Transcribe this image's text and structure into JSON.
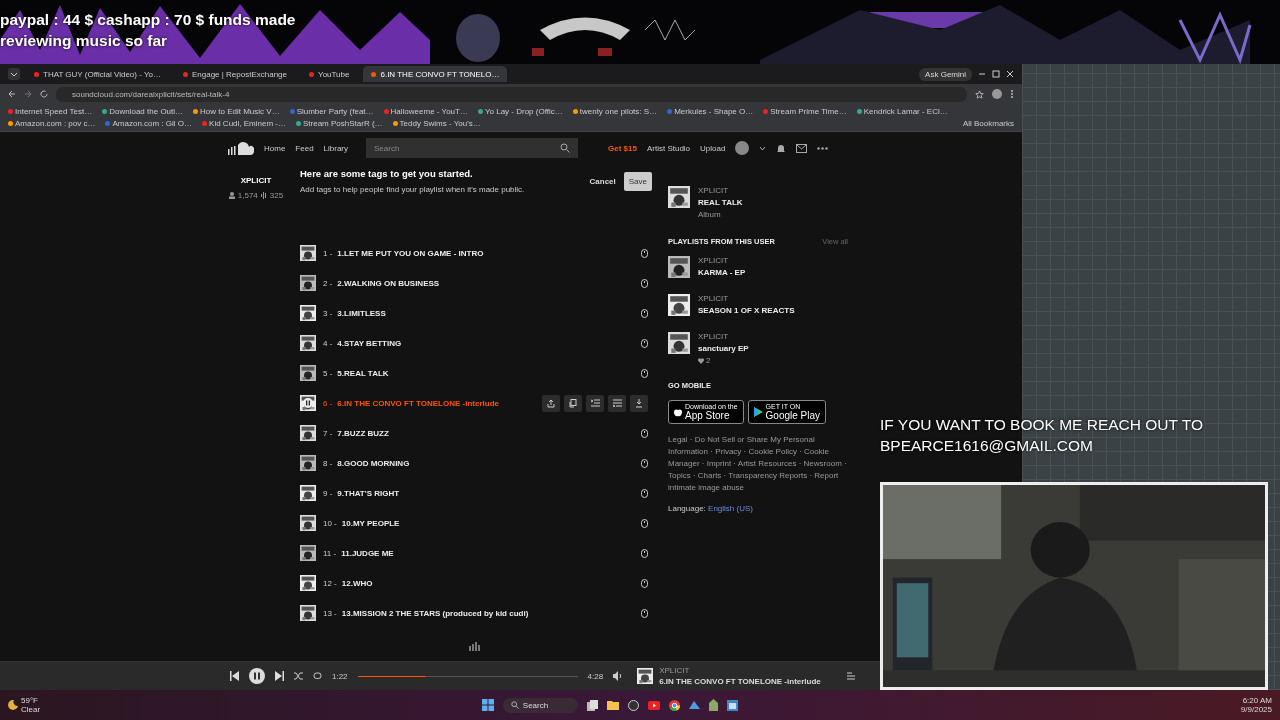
{
  "overlay": {
    "funds_lines": [
      "paypal : 44 $  cashapp : 70 $ funds made",
      "reviewing music so far"
    ],
    "booking_lines": [
      "IF YOU WANT TO BOOK ME REACH OUT TO",
      "BPEARCE1616@GMAIL.COM"
    ]
  },
  "browser": {
    "tabs": [
      {
        "title": "THAT GUY (Official Video) - Yo…",
        "selected": false
      },
      {
        "title": "Engage | RepostExchange",
        "selected": false
      },
      {
        "title": "YouTube",
        "selected": false
      },
      {
        "title": "6.IN THE CONVO FT TONELO…",
        "selected": true
      }
    ],
    "gemini_button": "Ask Gemini",
    "url": "soundcloud.com/darealxplicit/sets/real-talk-4",
    "bookmarks": [
      "Internet Speed Test…",
      "Download the Outl…",
      "How to Edit Music V…",
      "Slumber Party (feat…",
      "Halloweeme - YouT…",
      "Yo Lay - Drop (Offic…",
      "twenty one pilots: S…",
      "Merkules - Shape O…",
      "Stream Prime Time…",
      "Kendrick Lamar - ECl…",
      "Amazon.com : pov c…",
      "Amazon.com : Gil O…",
      "Kid Cudi, Eminem -…",
      "Stream PoshStarR (…",
      "Teddy Swims - You's…"
    ],
    "all_bookmarks": "All Bookmarks"
  },
  "header": {
    "nav": [
      "Home",
      "Feed",
      "Library"
    ],
    "search_placeholder": "Search",
    "promo": "Get $15",
    "links": [
      "Artist Studio",
      "Upload"
    ]
  },
  "profile": {
    "name": "XPLICIT",
    "followers": "1,574",
    "following": "325"
  },
  "tags_prompt": {
    "title": "Here are some tags to get you started.",
    "text": "Add tags to help people find your playlist when it's made public.",
    "cancel": "Cancel",
    "save": "Save"
  },
  "tracks": [
    {
      "number": "1 -",
      "title": "1.LET ME PUT YOU ON GAME - INTRO",
      "selected": false
    },
    {
      "number": "2 -",
      "title": "2.WALKING ON BUSINESS",
      "selected": false
    },
    {
      "number": "3 -",
      "title": "3.LIMITLESS",
      "selected": false
    },
    {
      "number": "4 -",
      "title": "4.STAY BETTING",
      "selected": false
    },
    {
      "number": "5 -",
      "title": "5.REAL TALK",
      "selected": false
    },
    {
      "number": "6 -",
      "title": "6.IN THE CONVO FT TONELONE -interlude",
      "selected": true
    },
    {
      "number": "7 -",
      "title": "7.BUZZ BUZZ",
      "selected": false
    },
    {
      "number": "8 -",
      "title": "8.GOOD MORNING",
      "selected": false
    },
    {
      "number": "9 -",
      "title": "9.THAT'S RIGHT",
      "selected": false
    },
    {
      "number": "10 -",
      "title": "10.MY PEOPLE",
      "selected": false
    },
    {
      "number": "11 -",
      "title": "11.JUDGE ME",
      "selected": false
    },
    {
      "number": "12 -",
      "title": "12.WHO",
      "selected": false
    },
    {
      "number": "13 -",
      "title": "13.MISSION 2 THE STARS (produced by kid cudi)",
      "selected": false
    }
  ],
  "sidebar": {
    "album": {
      "artist": "XPLICIT",
      "title": "REAL TALK",
      "type": "Album"
    },
    "playlists_heading": "PLAYLISTS FROM THIS USER",
    "view_all": "View all",
    "playlists": [
      {
        "artist": "XPLICIT",
        "title": "KARMA - EP"
      },
      {
        "artist": "XPLICIT",
        "title": "SEASON 1 OF X REACTS"
      },
      {
        "artist": "XPLICIT",
        "title": "sanctuary EP",
        "likes": "2"
      }
    ],
    "mobile_heading": "GO MOBILE",
    "app_store": {
      "small": "Download on the",
      "big": "App Store"
    },
    "google_play": {
      "small": "GET IT ON",
      "big": "Google Play"
    },
    "footer_text": "Legal · Do Not Sell or Share My Personal Information · Privacy · Cookie Policy · Cookie Manager · Imprint · Artist Resources · Newsroom · Topics · Charts · Transparency Reports · Report intimate image abuse",
    "language_label": "Language:",
    "language": "English (US)"
  },
  "player": {
    "playing": true,
    "elapsed": "1:22",
    "duration": "4:28",
    "level": 0.31,
    "artist": "XPLICIT",
    "title": "6.IN THE CONVO FT TONELONE -interlude"
  },
  "taskbar": {
    "temperature": "59°F",
    "weather": "Clear",
    "search": "Search",
    "time": "6:20 AM",
    "date": "9/9/2025"
  }
}
